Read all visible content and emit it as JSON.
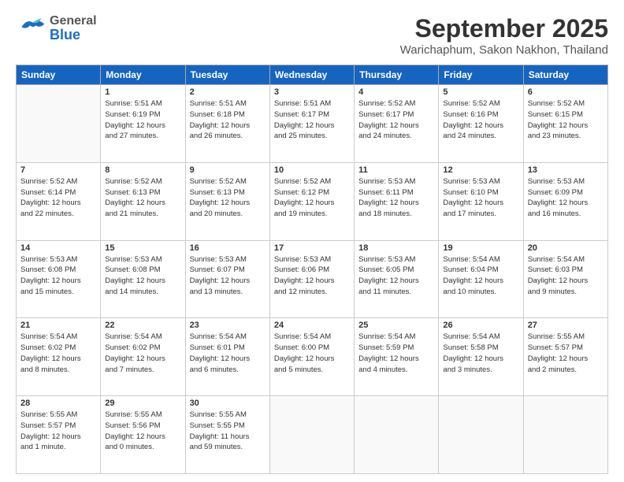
{
  "header": {
    "logo_general": "General",
    "logo_blue": "Blue",
    "month_title": "September 2025",
    "subtitle": "Warichaphum, Sakon Nakhon, Thailand"
  },
  "days_of_week": [
    "Sunday",
    "Monday",
    "Tuesday",
    "Wednesday",
    "Thursday",
    "Friday",
    "Saturday"
  ],
  "weeks": [
    [
      {
        "day": "",
        "info": ""
      },
      {
        "day": "1",
        "info": "Sunrise: 5:51 AM\nSunset: 6:19 PM\nDaylight: 12 hours\nand 27 minutes."
      },
      {
        "day": "2",
        "info": "Sunrise: 5:51 AM\nSunset: 6:18 PM\nDaylight: 12 hours\nand 26 minutes."
      },
      {
        "day": "3",
        "info": "Sunrise: 5:51 AM\nSunset: 6:17 PM\nDaylight: 12 hours\nand 25 minutes."
      },
      {
        "day": "4",
        "info": "Sunrise: 5:52 AM\nSunset: 6:17 PM\nDaylight: 12 hours\nand 24 minutes."
      },
      {
        "day": "5",
        "info": "Sunrise: 5:52 AM\nSunset: 6:16 PM\nDaylight: 12 hours\nand 24 minutes."
      },
      {
        "day": "6",
        "info": "Sunrise: 5:52 AM\nSunset: 6:15 PM\nDaylight: 12 hours\nand 23 minutes."
      }
    ],
    [
      {
        "day": "7",
        "info": "Sunrise: 5:52 AM\nSunset: 6:14 PM\nDaylight: 12 hours\nand 22 minutes."
      },
      {
        "day": "8",
        "info": "Sunrise: 5:52 AM\nSunset: 6:13 PM\nDaylight: 12 hours\nand 21 minutes."
      },
      {
        "day": "9",
        "info": "Sunrise: 5:52 AM\nSunset: 6:13 PM\nDaylight: 12 hours\nand 20 minutes."
      },
      {
        "day": "10",
        "info": "Sunrise: 5:52 AM\nSunset: 6:12 PM\nDaylight: 12 hours\nand 19 minutes."
      },
      {
        "day": "11",
        "info": "Sunrise: 5:53 AM\nSunset: 6:11 PM\nDaylight: 12 hours\nand 18 minutes."
      },
      {
        "day": "12",
        "info": "Sunrise: 5:53 AM\nSunset: 6:10 PM\nDaylight: 12 hours\nand 17 minutes."
      },
      {
        "day": "13",
        "info": "Sunrise: 5:53 AM\nSunset: 6:09 PM\nDaylight: 12 hours\nand 16 minutes."
      }
    ],
    [
      {
        "day": "14",
        "info": "Sunrise: 5:53 AM\nSunset: 6:08 PM\nDaylight: 12 hours\nand 15 minutes."
      },
      {
        "day": "15",
        "info": "Sunrise: 5:53 AM\nSunset: 6:08 PM\nDaylight: 12 hours\nand 14 minutes."
      },
      {
        "day": "16",
        "info": "Sunrise: 5:53 AM\nSunset: 6:07 PM\nDaylight: 12 hours\nand 13 minutes."
      },
      {
        "day": "17",
        "info": "Sunrise: 5:53 AM\nSunset: 6:06 PM\nDaylight: 12 hours\nand 12 minutes."
      },
      {
        "day": "18",
        "info": "Sunrise: 5:53 AM\nSunset: 6:05 PM\nDaylight: 12 hours\nand 11 minutes."
      },
      {
        "day": "19",
        "info": "Sunrise: 5:54 AM\nSunset: 6:04 PM\nDaylight: 12 hours\nand 10 minutes."
      },
      {
        "day": "20",
        "info": "Sunrise: 5:54 AM\nSunset: 6:03 PM\nDaylight: 12 hours\nand 9 minutes."
      }
    ],
    [
      {
        "day": "21",
        "info": "Sunrise: 5:54 AM\nSunset: 6:02 PM\nDaylight: 12 hours\nand 8 minutes."
      },
      {
        "day": "22",
        "info": "Sunrise: 5:54 AM\nSunset: 6:02 PM\nDaylight: 12 hours\nand 7 minutes."
      },
      {
        "day": "23",
        "info": "Sunrise: 5:54 AM\nSunset: 6:01 PM\nDaylight: 12 hours\nand 6 minutes."
      },
      {
        "day": "24",
        "info": "Sunrise: 5:54 AM\nSunset: 6:00 PM\nDaylight: 12 hours\nand 5 minutes."
      },
      {
        "day": "25",
        "info": "Sunrise: 5:54 AM\nSunset: 5:59 PM\nDaylight: 12 hours\nand 4 minutes."
      },
      {
        "day": "26",
        "info": "Sunrise: 5:54 AM\nSunset: 5:58 PM\nDaylight: 12 hours\nand 3 minutes."
      },
      {
        "day": "27",
        "info": "Sunrise: 5:55 AM\nSunset: 5:57 PM\nDaylight: 12 hours\nand 2 minutes."
      }
    ],
    [
      {
        "day": "28",
        "info": "Sunrise: 5:55 AM\nSunset: 5:57 PM\nDaylight: 12 hours\nand 1 minute."
      },
      {
        "day": "29",
        "info": "Sunrise: 5:55 AM\nSunset: 5:56 PM\nDaylight: 12 hours\nand 0 minutes."
      },
      {
        "day": "30",
        "info": "Sunrise: 5:55 AM\nSunset: 5:55 PM\nDaylight: 11 hours\nand 59 minutes."
      },
      {
        "day": "",
        "info": ""
      },
      {
        "day": "",
        "info": ""
      },
      {
        "day": "",
        "info": ""
      },
      {
        "day": "",
        "info": ""
      }
    ]
  ]
}
